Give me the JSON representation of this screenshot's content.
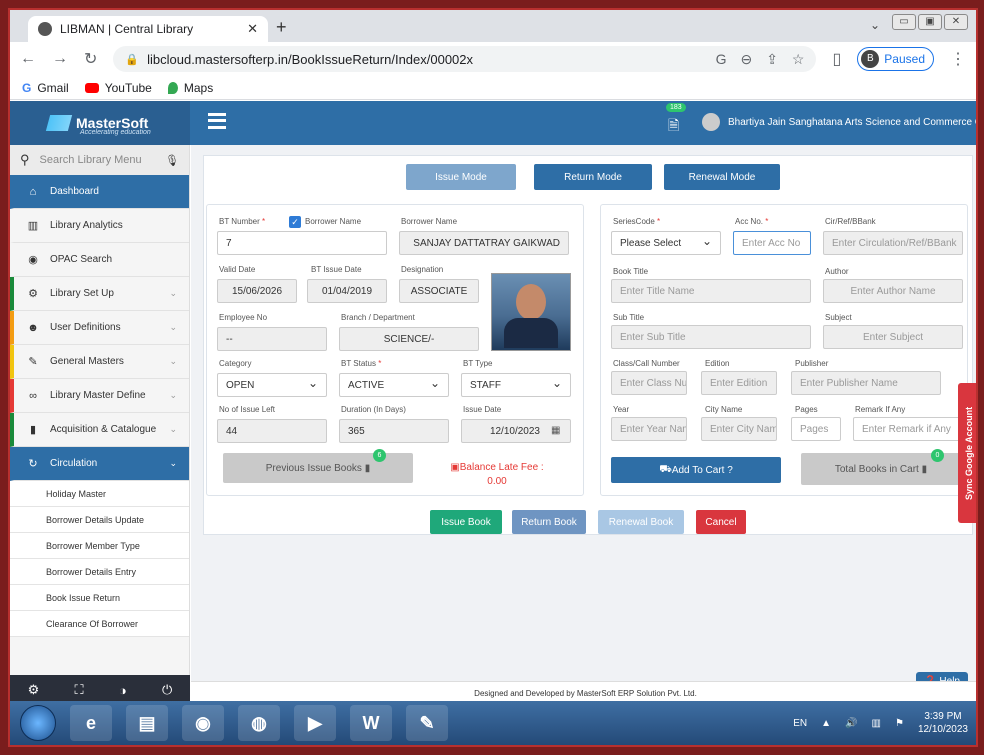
{
  "browser": {
    "tab_title": "LIBMAN | Central Library",
    "url": "libcloud.mastersofterp.in/BookIssueReturn/Index/00002x",
    "profile_letter": "B",
    "profile_status": "Paused",
    "bookmarks": [
      "Gmail",
      "YouTube",
      "Maps"
    ]
  },
  "app": {
    "logo_name": "MasterSoft",
    "logo_tagline": "Accelerating education",
    "notification_count": "183",
    "college_name": "Bhartiya Jain Sanghatana Arts Science and Commerce College"
  },
  "sidebar": {
    "search_placeholder": "Search Library Menu",
    "items": [
      {
        "label": "Dashboard",
        "icon": "home-icon"
      },
      {
        "label": "Library Analytics",
        "icon": "bar-chart-icon"
      },
      {
        "label": "OPAC Search",
        "icon": "globe-icon"
      },
      {
        "label": "Library Set Up",
        "icon": "cogs-icon"
      },
      {
        "label": "User Definitions",
        "icon": "users-icon"
      },
      {
        "label": "General Masters",
        "icon": "edit-icon"
      },
      {
        "label": "Library Master Define",
        "icon": "link-icon"
      },
      {
        "label": "Acquisition & Catalogue",
        "icon": "book-icon"
      },
      {
        "label": "Circulation",
        "icon": "refresh-icon"
      }
    ],
    "sub_items": [
      "Holiday Master",
      "Borrower Details Update",
      "Borrower Member Type",
      "Borrower Details Entry",
      "Book Issue Return",
      "Clearance Of Borrower"
    ],
    "accent_colors": [
      "#1a8a3a",
      "#f39c12",
      "#f1c40f",
      "#e53935",
      "#1a8a3a"
    ]
  },
  "modes": {
    "issue": "Issue Mode",
    "return": "Return Mode",
    "renewal": "Renewal Mode"
  },
  "borrower": {
    "bt_number_label": "BT Number",
    "bt_number_value": "7",
    "borrower_name_check_label": "Borrower Name",
    "borrower_name_label": "Borrower Name",
    "borrower_name_value": "SANJAY DATTATRAY GAIKWAD",
    "valid_date_label": "Valid Date",
    "valid_date_value": "15/06/2026",
    "bt_issue_date_label": "BT Issue Date",
    "bt_issue_date_value": "01/04/2019",
    "designation_label": "Designation",
    "designation_value": "ASSOCIATE",
    "employee_no_label": "Employee No",
    "employee_no_value": "--",
    "branch_label": "Branch / Department",
    "branch_value": "SCIENCE/-",
    "category_label": "Category",
    "category_value": "OPEN",
    "bt_status_label": "BT Status",
    "bt_status_value": "ACTIVE",
    "bt_type_label": "BT Type",
    "bt_type_value": "STAFF",
    "issue_left_label": "No of Issue Left",
    "issue_left_value": "44",
    "duration_label": "Duration (In Days)",
    "duration_value": "365",
    "issue_date_label": "Issue Date",
    "issue_date_value": "12/10/2023",
    "prev_issue_label": "Previous Issue Books",
    "prev_issue_count": "6",
    "balance_label": "Balance Late Fee :",
    "balance_value": "0.00"
  },
  "book": {
    "series_label": "SeriesCode",
    "series_value": "Please Select",
    "acc_label": "Acc No.",
    "acc_placeholder": "Enter Acc No",
    "cir_label": "Cir/Ref/BBank",
    "cir_placeholder": "Enter Circulation/Ref/BBank",
    "title_label": "Book Title",
    "title_placeholder": "Enter Title Name",
    "author_label": "Author",
    "author_placeholder": "Enter Author Name",
    "subtitle_label": "Sub Title",
    "subtitle_placeholder": "Enter Sub Title",
    "subject_label": "Subject",
    "subject_placeholder": "Enter Subject",
    "class_label": "Class/Call Number",
    "class_placeholder": "Enter Class Number",
    "edition_label": "Edition",
    "edition_placeholder": "Enter Edition",
    "publisher_label": "Publisher",
    "publisher_placeholder": "Enter Publisher Name",
    "year_label": "Year",
    "year_placeholder": "Enter Year Name",
    "city_label": "City Name",
    "city_placeholder": "Enter City Name",
    "pages_label": "Pages",
    "pages_placeholder": "Pages",
    "remark_label": "Remark If Any",
    "remark_placeholder": "Enter Remark if Any",
    "add_cart_label": "Add To Cart ?",
    "total_cart_label": "Total Books in Cart",
    "total_cart_count": "0"
  },
  "actions": {
    "issue": "Issue Book",
    "return": "Return Book",
    "renewal": "Renewal Book",
    "cancel": "Cancel"
  },
  "sync_label": "Sync Google Account",
  "footer": "Designed and Developed by MasterSoft ERP Solution Pvt. Ltd.",
  "help_label": "Help",
  "taskbar": {
    "lang": "EN",
    "time": "3:39 PM",
    "date": "12/10/2023"
  },
  "colors": {
    "primary": "#2e6ea6",
    "issue_mode": "#7ea6cc",
    "issue_book": "#1fa87a",
    "return_book": "#6f95c2",
    "renewal_book": "#a9c7e4",
    "cancel": "#d9363e"
  }
}
